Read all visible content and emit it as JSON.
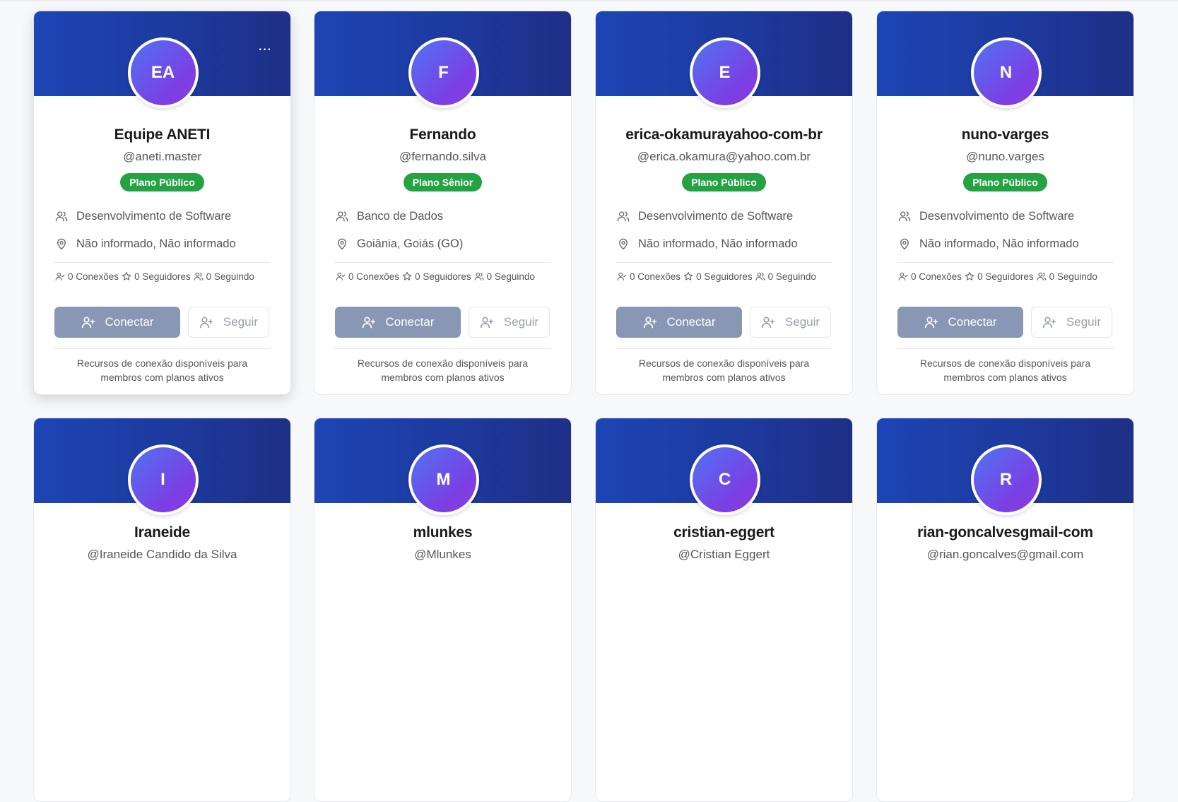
{
  "colors": {
    "banner": "#1d45b5",
    "avatar_from": "#4f73f2",
    "avatar_to": "#8a3be0",
    "badge": "#25a244",
    "connect_button": "#8797b4"
  },
  "cards": [
    {
      "initials": "EA",
      "name": "Equipe ANETI",
      "handle": "@aneti.master",
      "plan": "Plano Público",
      "area": "Desenvolvimento de Software",
      "location": "Não informado, Não informado",
      "connections": "0 Conexões",
      "followers": "0 Seguidores",
      "following": "0 Seguindo",
      "connect_label": "Conectar",
      "follow_label": "Seguir",
      "note": "Recursos de conexão disponíveis para membros com planos ativos",
      "menu": "···"
    },
    {
      "initials": "F",
      "name": "Fernando",
      "handle": "@fernando.silva",
      "plan": "Plano Sênior",
      "area": "Banco de Dados",
      "location": "Goiânia, Goiás (GO)",
      "connections": "0 Conexões",
      "followers": "0 Seguidores",
      "following": "0 Seguindo",
      "connect_label": "Conectar",
      "follow_label": "Seguir",
      "note": "Recursos de conexão disponíveis para membros com planos ativos"
    },
    {
      "initials": "E",
      "name": "erica-okamurayahoo-com-br",
      "handle": "@erica.okamura@yahoo.com.br",
      "plan": "Plano Público",
      "area": "Desenvolvimento de Software",
      "location": "Não informado, Não informado",
      "connections": "0 Conexões",
      "followers": "0 Seguidores",
      "following": "0 Seguindo",
      "connect_label": "Conectar",
      "follow_label": "Seguir",
      "note": "Recursos de conexão disponíveis para membros com planos ativos"
    },
    {
      "initials": "N",
      "name": "nuno-varges",
      "handle": "@nuno.varges",
      "plan": "Plano Público",
      "area": "Desenvolvimento de Software",
      "location": "Não informado, Não informado",
      "connections": "0 Conexões",
      "followers": "0 Seguidores",
      "following": "0 Seguindo",
      "connect_label": "Conectar",
      "follow_label": "Seguir",
      "note": "Recursos de conexão disponíveis para membros com planos ativos"
    },
    {
      "initials": "I",
      "name": "Iraneide",
      "handle": "@Iraneide Candido da Silva"
    },
    {
      "initials": "M",
      "name": "mlunkes",
      "handle": "@Mlunkes"
    },
    {
      "initials": "C",
      "name": "cristian-eggert",
      "handle": "@Cristian Eggert"
    },
    {
      "initials": "R",
      "name": "rian-goncalvesgmail-com",
      "handle": "@rian.goncalves@gmail.com"
    }
  ]
}
